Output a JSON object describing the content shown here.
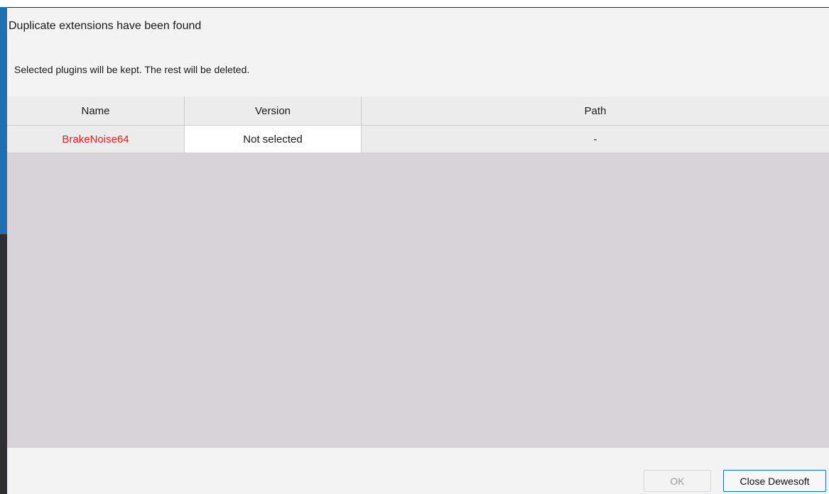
{
  "dialog": {
    "title": "Duplicate extensions have been found",
    "message": "Selected plugins will be kept. The rest will be deleted."
  },
  "table": {
    "columns": [
      "Name",
      "Version",
      "Path"
    ],
    "rows": [
      {
        "name": "BrakeNoise64",
        "version": "Not selected",
        "path": "-"
      }
    ]
  },
  "buttons": {
    "ok_label": "OK",
    "close_label": "Close Dewesoft"
  },
  "colors": {
    "accent": "#1a6cc4",
    "duplicate_name": "#ee1c1c",
    "grid_background": "#d8d3d8"
  }
}
